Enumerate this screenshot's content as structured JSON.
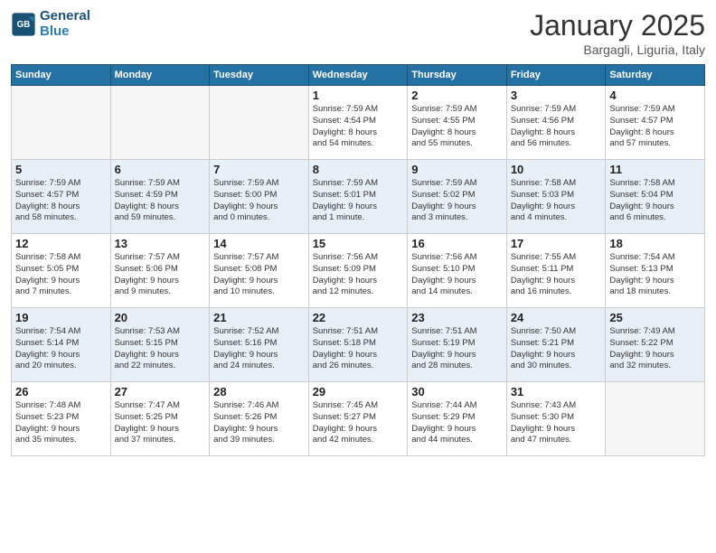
{
  "logo": {
    "line1": "General",
    "line2": "Blue"
  },
  "title": "January 2025",
  "location": "Bargagli, Liguria, Italy",
  "weekdays": [
    "Sunday",
    "Monday",
    "Tuesday",
    "Wednesday",
    "Thursday",
    "Friday",
    "Saturday"
  ],
  "weeks": [
    [
      {
        "day": "",
        "info": ""
      },
      {
        "day": "",
        "info": ""
      },
      {
        "day": "",
        "info": ""
      },
      {
        "day": "1",
        "info": "Sunrise: 7:59 AM\nSunset: 4:54 PM\nDaylight: 8 hours\nand 54 minutes."
      },
      {
        "day": "2",
        "info": "Sunrise: 7:59 AM\nSunset: 4:55 PM\nDaylight: 8 hours\nand 55 minutes."
      },
      {
        "day": "3",
        "info": "Sunrise: 7:59 AM\nSunset: 4:56 PM\nDaylight: 8 hours\nand 56 minutes."
      },
      {
        "day": "4",
        "info": "Sunrise: 7:59 AM\nSunset: 4:57 PM\nDaylight: 8 hours\nand 57 minutes."
      }
    ],
    [
      {
        "day": "5",
        "info": "Sunrise: 7:59 AM\nSunset: 4:57 PM\nDaylight: 8 hours\nand 58 minutes."
      },
      {
        "day": "6",
        "info": "Sunrise: 7:59 AM\nSunset: 4:59 PM\nDaylight: 8 hours\nand 59 minutes."
      },
      {
        "day": "7",
        "info": "Sunrise: 7:59 AM\nSunset: 5:00 PM\nDaylight: 9 hours\nand 0 minutes."
      },
      {
        "day": "8",
        "info": "Sunrise: 7:59 AM\nSunset: 5:01 PM\nDaylight: 9 hours\nand 1 minute."
      },
      {
        "day": "9",
        "info": "Sunrise: 7:59 AM\nSunset: 5:02 PM\nDaylight: 9 hours\nand 3 minutes."
      },
      {
        "day": "10",
        "info": "Sunrise: 7:58 AM\nSunset: 5:03 PM\nDaylight: 9 hours\nand 4 minutes."
      },
      {
        "day": "11",
        "info": "Sunrise: 7:58 AM\nSunset: 5:04 PM\nDaylight: 9 hours\nand 6 minutes."
      }
    ],
    [
      {
        "day": "12",
        "info": "Sunrise: 7:58 AM\nSunset: 5:05 PM\nDaylight: 9 hours\nand 7 minutes."
      },
      {
        "day": "13",
        "info": "Sunrise: 7:57 AM\nSunset: 5:06 PM\nDaylight: 9 hours\nand 9 minutes."
      },
      {
        "day": "14",
        "info": "Sunrise: 7:57 AM\nSunset: 5:08 PM\nDaylight: 9 hours\nand 10 minutes."
      },
      {
        "day": "15",
        "info": "Sunrise: 7:56 AM\nSunset: 5:09 PM\nDaylight: 9 hours\nand 12 minutes."
      },
      {
        "day": "16",
        "info": "Sunrise: 7:56 AM\nSunset: 5:10 PM\nDaylight: 9 hours\nand 14 minutes."
      },
      {
        "day": "17",
        "info": "Sunrise: 7:55 AM\nSunset: 5:11 PM\nDaylight: 9 hours\nand 16 minutes."
      },
      {
        "day": "18",
        "info": "Sunrise: 7:54 AM\nSunset: 5:13 PM\nDaylight: 9 hours\nand 18 minutes."
      }
    ],
    [
      {
        "day": "19",
        "info": "Sunrise: 7:54 AM\nSunset: 5:14 PM\nDaylight: 9 hours\nand 20 minutes."
      },
      {
        "day": "20",
        "info": "Sunrise: 7:53 AM\nSunset: 5:15 PM\nDaylight: 9 hours\nand 22 minutes."
      },
      {
        "day": "21",
        "info": "Sunrise: 7:52 AM\nSunset: 5:16 PM\nDaylight: 9 hours\nand 24 minutes."
      },
      {
        "day": "22",
        "info": "Sunrise: 7:51 AM\nSunset: 5:18 PM\nDaylight: 9 hours\nand 26 minutes."
      },
      {
        "day": "23",
        "info": "Sunrise: 7:51 AM\nSunset: 5:19 PM\nDaylight: 9 hours\nand 28 minutes."
      },
      {
        "day": "24",
        "info": "Sunrise: 7:50 AM\nSunset: 5:21 PM\nDaylight: 9 hours\nand 30 minutes."
      },
      {
        "day": "25",
        "info": "Sunrise: 7:49 AM\nSunset: 5:22 PM\nDaylight: 9 hours\nand 32 minutes."
      }
    ],
    [
      {
        "day": "26",
        "info": "Sunrise: 7:48 AM\nSunset: 5:23 PM\nDaylight: 9 hours\nand 35 minutes."
      },
      {
        "day": "27",
        "info": "Sunrise: 7:47 AM\nSunset: 5:25 PM\nDaylight: 9 hours\nand 37 minutes."
      },
      {
        "day": "28",
        "info": "Sunrise: 7:46 AM\nSunset: 5:26 PM\nDaylight: 9 hours\nand 39 minutes."
      },
      {
        "day": "29",
        "info": "Sunrise: 7:45 AM\nSunset: 5:27 PM\nDaylight: 9 hours\nand 42 minutes."
      },
      {
        "day": "30",
        "info": "Sunrise: 7:44 AM\nSunset: 5:29 PM\nDaylight: 9 hours\nand 44 minutes."
      },
      {
        "day": "31",
        "info": "Sunrise: 7:43 AM\nSunset: 5:30 PM\nDaylight: 9 hours\nand 47 minutes."
      },
      {
        "day": "",
        "info": ""
      }
    ]
  ]
}
